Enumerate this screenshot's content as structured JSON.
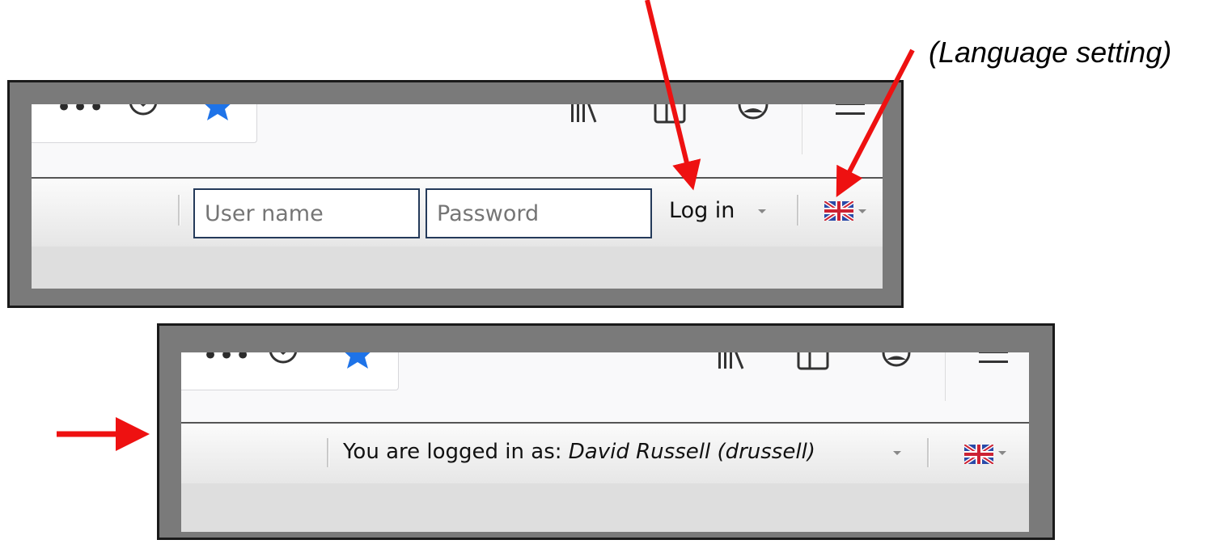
{
  "annotations": {
    "language_setting": "(Language setting)"
  },
  "toolbar": {
    "icons": [
      "more-icon",
      "pocket-icon",
      "bookmark-star-icon",
      "library-icon",
      "sidebar-icon",
      "account-icon",
      "menu-icon"
    ]
  },
  "login_bar": {
    "username_placeholder": "User name",
    "password_placeholder": "Password",
    "login_label": "Log in"
  },
  "logged_in_bar": {
    "prefix": "You are logged in as: ",
    "user": "David Russell (drussell)"
  },
  "colors": {
    "arrow": "#ee1111",
    "star": "#1e73e8",
    "input_border": "#243a5a"
  }
}
